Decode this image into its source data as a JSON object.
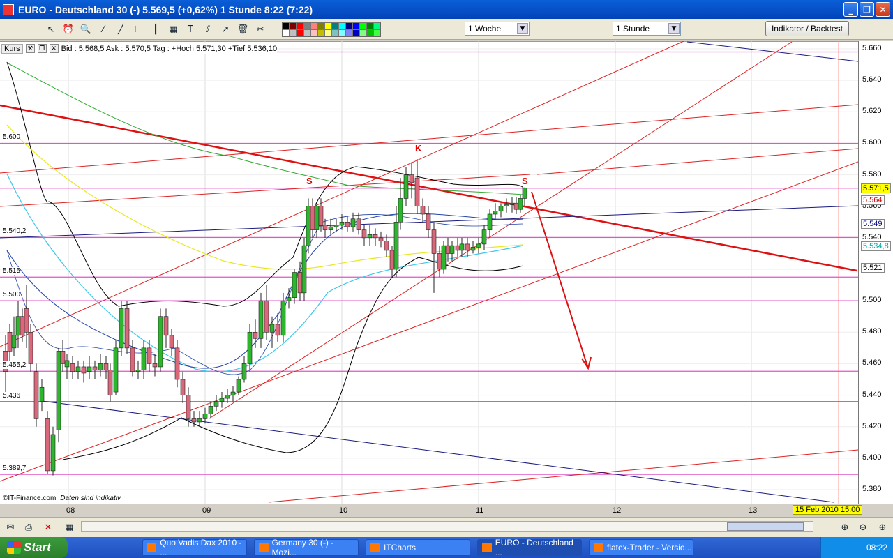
{
  "window": {
    "title": "EURO - Deutschland 30 (-)    5.569,5 (+0,62%)    1 Stunde   8:22 (7:22)",
    "min": "_",
    "max": "❐",
    "close": "✕"
  },
  "toolbar": {
    "icons": [
      "cursor-icon",
      "alarm-icon",
      "zoom-icon",
      "line-icon",
      "ray-icon",
      "hline-icon",
      "vline-icon",
      "channel-icon",
      "text-icon",
      "fib-icon",
      "arrow-icon",
      "trash-icon",
      "tools-icon"
    ],
    "icon_glyphs": [
      "↖",
      "⏰",
      "🔍",
      "⁄",
      "╱",
      "⊢",
      "┃",
      "▦",
      "T",
      "⫽",
      "↗",
      "🗑",
      "✂"
    ],
    "period_select": "1 Woche",
    "interval_select": "1 Stunde",
    "indicator_button": "Indikator / Backtest",
    "palette": [
      "#000000",
      "#800000",
      "#ff0000",
      "#808080",
      "#ff8080",
      "#808000",
      "#ffff00",
      "#008080",
      "#00ffff",
      "#000080",
      "#0000ff",
      "#00ff00",
      "#008000",
      "#00ff80",
      "#ffffff",
      "#c0c0c0",
      "#ff0000",
      "#c0c0c0",
      "#ffc0c0",
      "#c0c000",
      "#ffff80",
      "#80c0c0",
      "#80ffff",
      "#8080ff",
      "#0000c0",
      "#80ff80",
      "#00c000",
      "#40ff40"
    ]
  },
  "infobar": {
    "kurs": "Kurs",
    "quote": "Bid : 5.568,5  Ask : 5.570,5  Tag : +Hoch 5.571,30 +Tief 5.536,10"
  },
  "y_axis": [
    "5.660",
    "5.640",
    "5.620",
    "5.600",
    "5.580",
    "5.560",
    "5.540",
    "5.520",
    "5.500",
    "5.480",
    "5.460",
    "5.440",
    "5.420",
    "5.400",
    "5.380"
  ],
  "left_tags": [
    "5.600",
    "5.540,2",
    "5.515",
    "5.500",
    "5.455,2",
    "5.436",
    "5.389,7"
  ],
  "price_boxes": [
    {
      "text": "5.571,5",
      "bg": "#ffff00",
      "color": "#000000"
    },
    {
      "text": "5.564",
      "bg": "#ffffff",
      "color": "#cc0000"
    },
    {
      "text": "5.549",
      "bg": "#ffffff",
      "color": "#000080"
    },
    {
      "text": "5.534,8",
      "bg": "#ffffff",
      "color": "#00aaaa"
    },
    {
      "text": "5.521",
      "bg": "#ffffff",
      "color": "#000000"
    }
  ],
  "x_axis": [
    "08",
    "09",
    "10",
    "11",
    "12",
    "13"
  ],
  "date_box": "15 Feb 2010 15:00",
  "copyright": "©IT-Finance.com",
  "disclaimer": "Daten sind indikativ",
  "labels": {
    "s1": "S",
    "k": "K",
    "s2": "S"
  },
  "taskbar": {
    "start": "Start",
    "tasks": [
      "Quo Vadis Dax 2010 - ...",
      "Germany 30 (-) - Mozi...",
      "ITCharts",
      "EURO - Deutschland ...",
      "flatex-Trader - Versio..."
    ],
    "clock": "08:22"
  }
}
